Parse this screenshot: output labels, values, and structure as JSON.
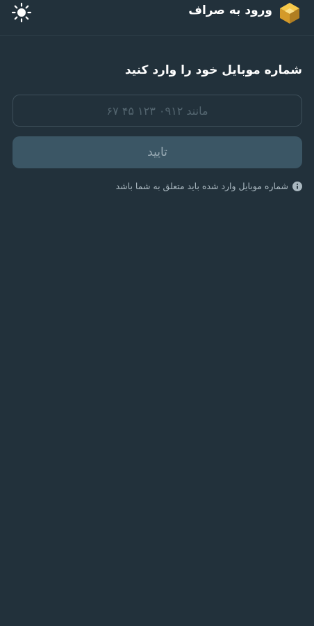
{
  "header": {
    "title": "ورود به صراف",
    "logo_icon": "cube-logo-icon",
    "theme_icon": "sun-icon"
  },
  "login": {
    "prompt": "شماره موبایل خود را وارد کنید",
    "phone_placeholder": "مانند ۰۹۱۲ ۱۲۳ ۴۵ ۶۷",
    "phone_value": "",
    "confirm_label": "تایید",
    "hint_icon": "info-icon",
    "hint": "شماره موبایل وارد شده باید متعلق به شما باشد"
  },
  "colors": {
    "background": "#22313b",
    "button": "#3b5665",
    "button_text": "#98aab4",
    "logo_yellow": "#f2b632",
    "logo_gold": "#c8902a"
  }
}
